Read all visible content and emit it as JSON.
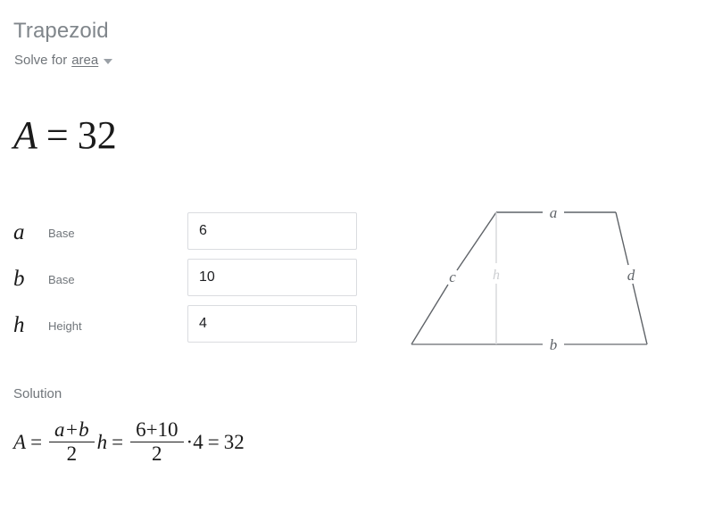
{
  "header": {
    "title": "Trapezoid",
    "solve_for_prefix": "Solve for",
    "solve_for_value": "area",
    "caret_icon": "chevron-down-icon"
  },
  "result": {
    "variable": "A",
    "operator": "=",
    "value": "32"
  },
  "inputs": [
    {
      "symbol": "a",
      "label": "Base",
      "value": "6",
      "placeholder": ""
    },
    {
      "symbol": "b",
      "label": "Base",
      "value": "10",
      "placeholder": ""
    },
    {
      "symbol": "h",
      "label": "Height",
      "value": "4",
      "placeholder": ""
    }
  ],
  "figure": {
    "name": "trapezoid-diagram",
    "labels": {
      "top": "a",
      "bottom": "b",
      "left": "c",
      "right": "d",
      "height": "h"
    },
    "colors": {
      "outline": "#5f6368",
      "height_line": "#d5d7da",
      "label": "#5f6368",
      "height_label": "#cdcfd2"
    }
  },
  "solution": {
    "title": "Solution",
    "lhs_variable": "A",
    "equals_1": "=",
    "frac1_numerator": "a+b",
    "frac1_denominator": "2",
    "multiplier_variable": "h",
    "equals_2": "=",
    "frac2_numerator": "6+10",
    "frac2_denominator": "2",
    "dot_operator": "·",
    "factor": "4",
    "equals_3": "=",
    "result": "32"
  },
  "colors": {
    "background": "#ffffff",
    "title": "#80868b",
    "muted_text": "#70757a",
    "primary_text": "#1a1a1a",
    "field_border": "#dadce0"
  }
}
